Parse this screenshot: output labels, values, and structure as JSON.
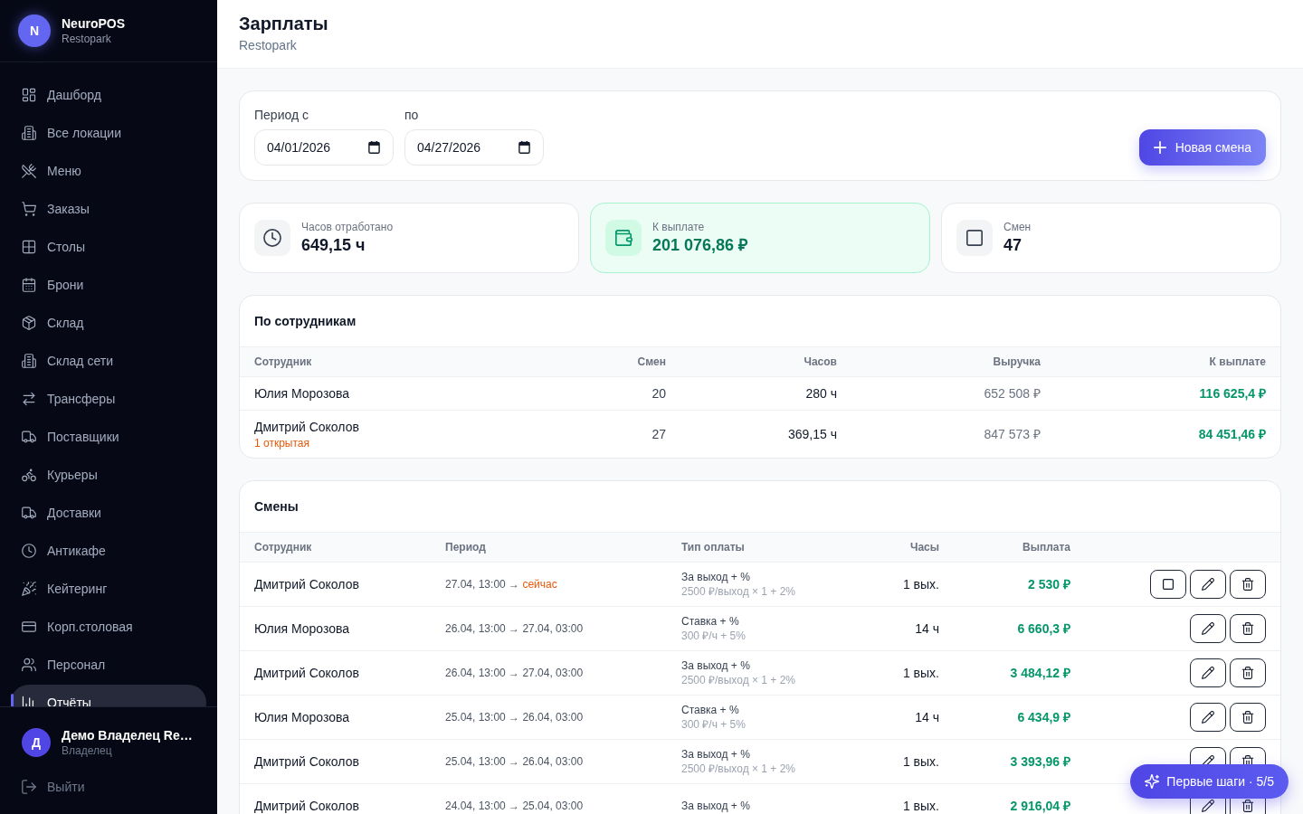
{
  "sidebar": {
    "brand": {
      "initial": "N",
      "name": "NeuroPOS",
      "subtitle": "Restopark"
    },
    "items": [
      {
        "label": "Дашборд",
        "selected": false
      },
      {
        "label": "Все локации",
        "selected": false
      },
      {
        "label": "Меню",
        "selected": false
      },
      {
        "label": "Заказы",
        "selected": false
      },
      {
        "label": "Столы",
        "selected": false
      },
      {
        "label": "Брони",
        "selected": false
      },
      {
        "label": "Склад",
        "selected": false
      },
      {
        "label": "Склад сети",
        "selected": false
      },
      {
        "label": "Трансферы",
        "selected": false
      },
      {
        "label": "Поставщики",
        "selected": false
      },
      {
        "label": "Курьеры",
        "selected": false
      },
      {
        "label": "Доставки",
        "selected": false
      },
      {
        "label": "Антикафе",
        "selected": false
      },
      {
        "label": "Кейтеринг",
        "selected": false
      },
      {
        "label": "Корп.столовая",
        "selected": false
      },
      {
        "label": "Персонал",
        "selected": false
      },
      {
        "label": "Отчёты",
        "selected": true
      }
    ],
    "user": {
      "initial": "Д",
      "name": "Демо Владелец Re…",
      "role": "Владелец"
    },
    "logout": "Выйти"
  },
  "header": {
    "title": "Зарплаты",
    "subtitle": "Restopark"
  },
  "filters": {
    "fields": [
      {
        "label": "Период с",
        "value": "04/01/2026"
      },
      {
        "label": "по",
        "value": "04/27/2026"
      }
    ],
    "new_shift_button": "Новая смена"
  },
  "stats": [
    {
      "label": "Часов отработано",
      "value": "649,15 ч",
      "highlighted": false
    },
    {
      "label": "К выплате",
      "value": "201 076,86 ₽",
      "highlighted": true
    },
    {
      "label": "Смен",
      "value": "47",
      "highlighted": false
    }
  ],
  "employees": {
    "title": "По сотрудникам",
    "columns": [
      "Сотрудник",
      "Смен",
      "Часов",
      "Выручка",
      "К выплате"
    ],
    "rows": [
      {
        "name": "Юлия Морозова",
        "shifts": "20",
        "hours": "280 ч",
        "revenue": "652 508 ₽",
        "payout": "116 625,4 ₽"
      },
      {
        "name": "Дмитрий Соколов",
        "note": "1 открытая",
        "shifts": "27",
        "hours": "369,15 ч",
        "revenue": "847 573 ₽",
        "payout": "84 451,46 ₽"
      }
    ]
  },
  "shifts": {
    "title": "Смены",
    "columns": [
      "Сотрудник",
      "Период",
      "Тип оплаты",
      "Часы",
      "Выплата"
    ],
    "rows": [
      {
        "employee": "Дмитрий Соколов",
        "period": {
          "from": "27.04, 13:00",
          "arrow": "→",
          "to": "сейчас"
        },
        "open": true,
        "pay_type": "За выход + %",
        "rate": "2500 ₽/выход × 1 + 2%",
        "hours": "1 вых.",
        "payout": "2 530 ₽"
      },
      {
        "employee": "Юлия Морозова",
        "period": {
          "from": "26.04, 13:00",
          "arrow": "→",
          "to": "27.04, 03:00"
        },
        "open": false,
        "pay_type": "Ставка + %",
        "rate": "300 ₽/ч + 5%",
        "hours": "14 ч",
        "payout": "6 660,3 ₽"
      },
      {
        "employee": "Дмитрий Соколов",
        "period": {
          "from": "26.04, 13:00",
          "arrow": "→",
          "to": "27.04, 03:00"
        },
        "open": false,
        "pay_type": "За выход + %",
        "rate": "2500 ₽/выход × 1 + 2%",
        "hours": "1 вых.",
        "payout": "3 484,12 ₽"
      },
      {
        "employee": "Юлия Морозова",
        "period": {
          "from": "25.04, 13:00",
          "arrow": "→",
          "to": "26.04, 03:00"
        },
        "open": false,
        "pay_type": "Ставка + %",
        "rate": "300 ₽/ч + 5%",
        "hours": "14 ч",
        "payout": "6 434,9 ₽"
      },
      {
        "employee": "Дмитрий Соколов",
        "period": {
          "from": "25.04, 13:00",
          "arrow": "→",
          "to": "26.04, 03:00"
        },
        "open": false,
        "pay_type": "За выход + %",
        "rate": "2500 ₽/выход × 1 + 2%",
        "hours": "1 вых.",
        "payout": "3 393,96 ₽"
      },
      {
        "employee": "Дмитрий Соколов",
        "period": {
          "from": "24.04, 13:00",
          "arrow": "→",
          "to": "25.04, 03:00"
        },
        "open": false,
        "pay_type": "За выход + %",
        "hours": "1 вых.",
        "payout": "2 916,04 ₽"
      }
    ]
  },
  "help_button": "Первые шаги · 5/5"
}
